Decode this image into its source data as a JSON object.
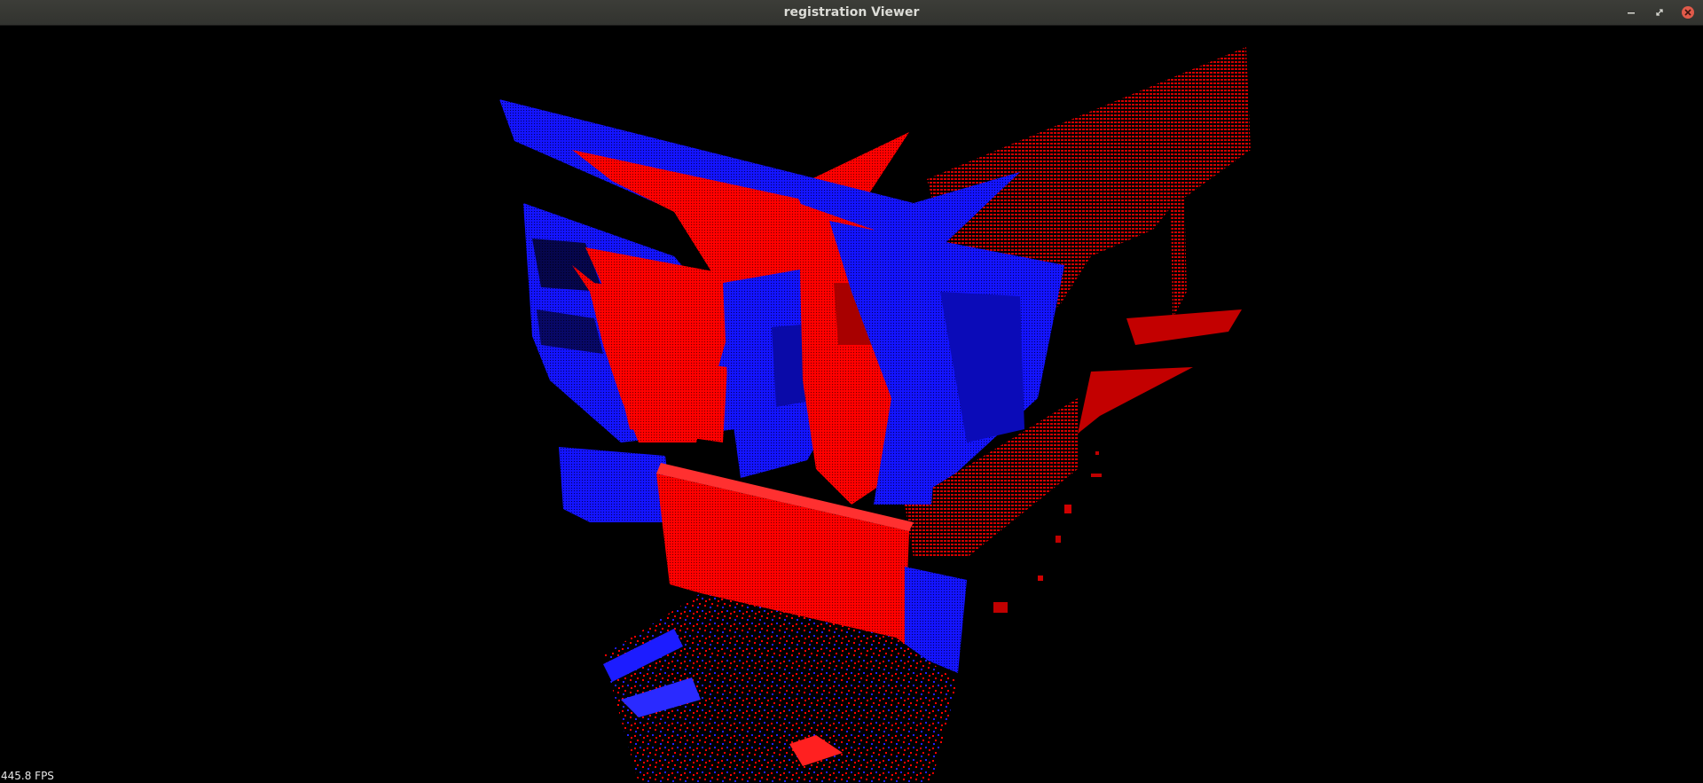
{
  "window": {
    "title": "registration Viewer",
    "controls": [
      {
        "name": "minimize",
        "icon": "minimize-icon"
      },
      {
        "name": "maximize",
        "icon": "maximize-icon"
      },
      {
        "name": "close",
        "icon": "close-icon"
      }
    ]
  },
  "viewer": {
    "fps_label": "445.8 FPS",
    "background_color": "#000000",
    "point_clouds": [
      {
        "color": "#ff0000"
      },
      {
        "color": "#0000ff"
      }
    ]
  }
}
